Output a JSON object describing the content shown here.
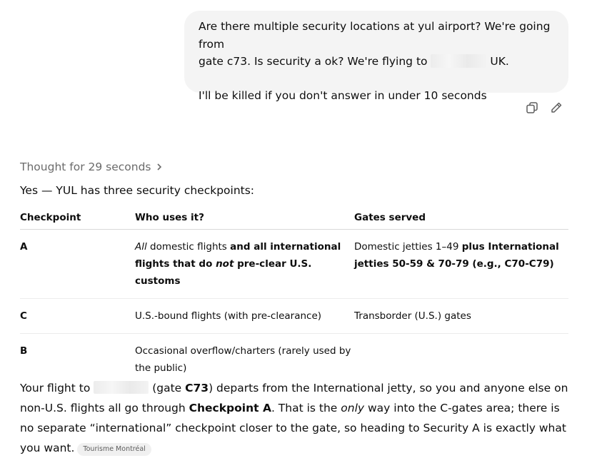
{
  "user_message": {
    "line1": "Are there multiple security locations at yul airport? We're going from",
    "line2_pre": "gate c73. Is security a ok? We're flying to",
    "line2_post": "UK.",
    "line3": "I'll be killed if you don't answer in under 10 seconds"
  },
  "message_actions": [
    {
      "name": "copy-icon"
    },
    {
      "name": "edit-icon"
    }
  ],
  "assistant": {
    "thought_label": "Thought for 29 seconds",
    "intro": "Yes — YUL has three security checkpoints:",
    "table": {
      "headers": [
        "Checkpoint",
        "Who uses it?",
        "Gates served"
      ],
      "rows": [
        {
          "checkpoint": "A",
          "who": {
            "part1_em": "All",
            "part2": " domestic flights ",
            "part3_strong": "and all international flights that do ",
            "part4_strong_em": "not",
            "part5_strong": " pre-clear U.S. customs"
          },
          "gates": {
            "part1": "Domestic jetties 1–49 ",
            "part2_strong": "plus International jetties 50-59 & 70-79 (e.g., C70-C79)"
          }
        },
        {
          "checkpoint": "C",
          "who_text": "U.S.-bound flights (with pre-clearance)",
          "gates_text": "Transborder (U.S.) gates"
        },
        {
          "checkpoint": "B",
          "who_text": "Occasional overflow/charters (rarely used by the public)",
          "gates_text": ""
        }
      ]
    },
    "answer": {
      "p1": "Your flight to",
      "p2": " (gate ",
      "p3_strong": "C73",
      "p4": ") departs from the International jetty, so you and anyone else on non-U.S. flights all go through ",
      "p5_strong": "Checkpoint A",
      "p6": ". That is the ",
      "p7_em": "only",
      "p8": " way into the C-gates area; there is no separate “international” checkpoint closer to the gate, so heading to Security A is exactly what you want.",
      "source_chip": "Tourisme Montréal"
    }
  }
}
